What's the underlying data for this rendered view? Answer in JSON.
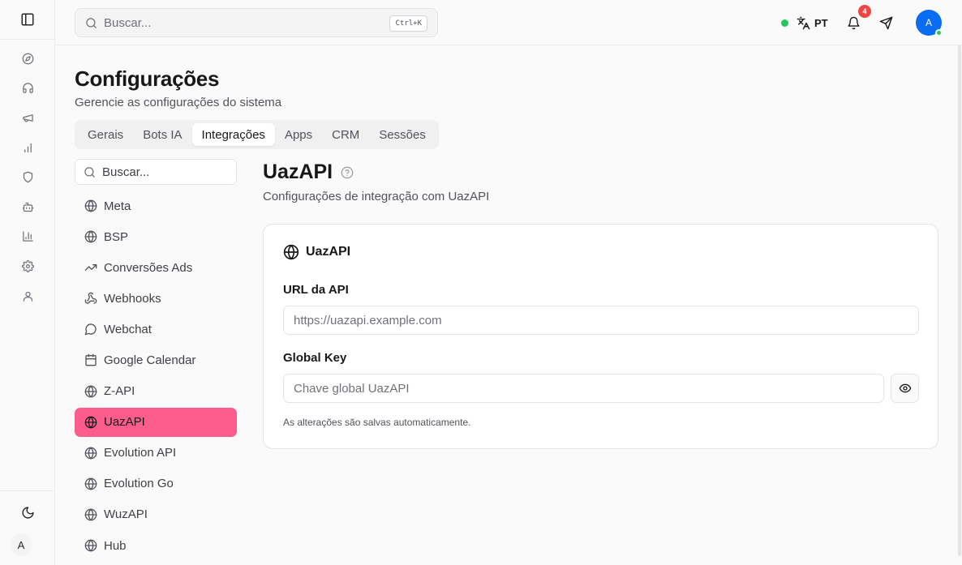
{
  "topbar": {
    "search_placeholder": "Buscar...",
    "search_shortcut": "Ctrl+K",
    "language": "PT",
    "notification_count": "4",
    "user_initial": "A"
  },
  "rail": {
    "items": [
      {
        "icon": "compass-icon"
      },
      {
        "icon": "headphones-icon"
      },
      {
        "icon": "megaphone-icon"
      },
      {
        "icon": "bar-chart-icon"
      },
      {
        "icon": "shield-icon"
      },
      {
        "icon": "bot-icon"
      },
      {
        "icon": "chart-icon"
      },
      {
        "icon": "gear-icon"
      },
      {
        "icon": "user-icon"
      }
    ],
    "avatar_initial": "A"
  },
  "page": {
    "title": "Configurações",
    "subtitle": "Gerencie as configurações do sistema"
  },
  "tabs": [
    {
      "label": "Gerais"
    },
    {
      "label": "Bots IA"
    },
    {
      "label": "Integrações",
      "active": true
    },
    {
      "label": "Apps"
    },
    {
      "label": "CRM"
    },
    {
      "label": "Sessões"
    }
  ],
  "integrations": {
    "search_placeholder": "Buscar...",
    "items": [
      {
        "label": "Meta",
        "icon": "globe-icon"
      },
      {
        "label": "BSP",
        "icon": "globe-icon"
      },
      {
        "label": "Conversões Ads",
        "icon": "trending-up-icon"
      },
      {
        "label": "Webhooks",
        "icon": "webhook-icon"
      },
      {
        "label": "Webchat",
        "icon": "chat-bubble-icon"
      },
      {
        "label": "Google Calendar",
        "icon": "calendar-icon"
      },
      {
        "label": "Z-API",
        "icon": "globe-icon"
      },
      {
        "label": "UazAPI",
        "icon": "globe-icon",
        "active": true
      },
      {
        "label": "Evolution API",
        "icon": "globe-icon"
      },
      {
        "label": "Evolution Go",
        "icon": "globe-icon"
      },
      {
        "label": "WuzAPI",
        "icon": "globe-icon"
      },
      {
        "label": "Hub",
        "icon": "globe-icon"
      }
    ]
  },
  "detail": {
    "title": "UazAPI",
    "subtitle": "Configurações de integração com UazAPI",
    "card": {
      "title": "UazAPI",
      "api_url_label": "URL da API",
      "api_url_placeholder": "https://uazapi.example.com",
      "api_url_value": "",
      "global_key_label": "Global Key",
      "global_key_placeholder": "Chave global UazAPI",
      "global_key_value": "",
      "note": "As alterações são salvas automaticamente."
    }
  },
  "colors": {
    "active_item": "#fd5d8d",
    "avatar": "#0a6cf0",
    "status": "#22c55e",
    "badge": "#ef4444"
  }
}
